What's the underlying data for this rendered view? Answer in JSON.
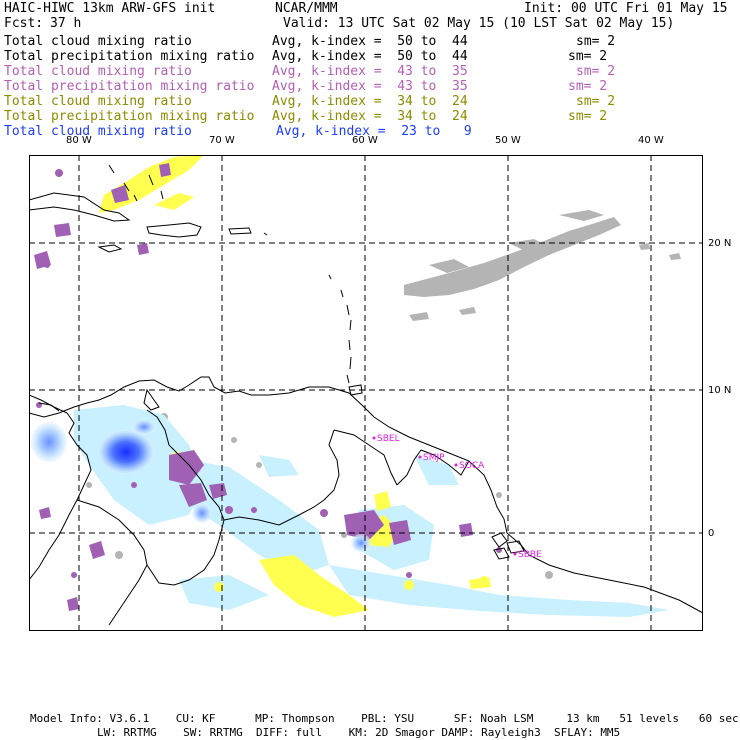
{
  "header": {
    "model_line": "HAIC-HIWC 13km ARW-GFS init",
    "institution": "NCAR/MMM",
    "init": "Init: 00 UTC Fri 01 May 15",
    "fcst_label": "Fcst:",
    "fcst_value": "37 h",
    "valid": "Valid: 13 UTC Sat 02 May 15 (10 LST Sat 02 May 15)"
  },
  "legend": [
    {
      "field": "Total cloud mixing ratio",
      "avg": "Avg, k-index =  50 to  44",
      "sm": "sm= 2",
      "color": "#000000"
    },
    {
      "field": "Total precipitation mixing ratio",
      "avg": "Avg, k-index =  50 to  44",
      "sm": "sm= 2",
      "color": "#000000"
    },
    {
      "field": "Total cloud mixing ratio",
      "avg": "Avg, k-index =  43 to  35",
      "sm": "sm= 2",
      "color": "#b45fb4"
    },
    {
      "field": "Total precipitation mixing ratio",
      "avg": "Avg, k-index =  43 to  35",
      "sm": "sm= 2",
      "color": "#b45fb4"
    },
    {
      "field": "Total cloud mixing ratio",
      "avg": "Avg, k-index =  34 to  24",
      "sm": "sm= 2",
      "color": "#8c8c00"
    },
    {
      "field": "Total precipitation mixing ratio",
      "avg": "Avg, k-index =  34 to  24",
      "sm": "sm= 2",
      "color": "#8c8c00"
    },
    {
      "field": "Total cloud mixing ratio",
      "avg": "Avg, k-index =  23 to   9",
      "sm": "",
      "color": "#1e3cff"
    }
  ],
  "map": {
    "lon_labels": [
      "80 W",
      "70 W",
      "60 W",
      "50 W",
      "40 W"
    ],
    "lat_labels": [
      "20 N",
      "10 N",
      "0"
    ],
    "stations": [
      "SBEL",
      "SMJP",
      "SOCA",
      "SBBE"
    ],
    "colors": {
      "gray": "#b4b4b4",
      "purple": "#a060b4",
      "yellow": "#ffff50",
      "cyan": "#c8f0ff",
      "blue": "#2846ff",
      "station": "#e01ee0"
    }
  },
  "footer": {
    "line1": "Model Info: V3.6.1    CU: KF      MP: Thompson    PBL: YSU      SF: Noah LSM     13 km   51 levels   60 sec",
    "line2": "LW: RRTMG    SW: RRTMG  DIFF: full    KM: 2D Smagor DAMP: Rayleigh3  SFLAY: MM5"
  }
}
